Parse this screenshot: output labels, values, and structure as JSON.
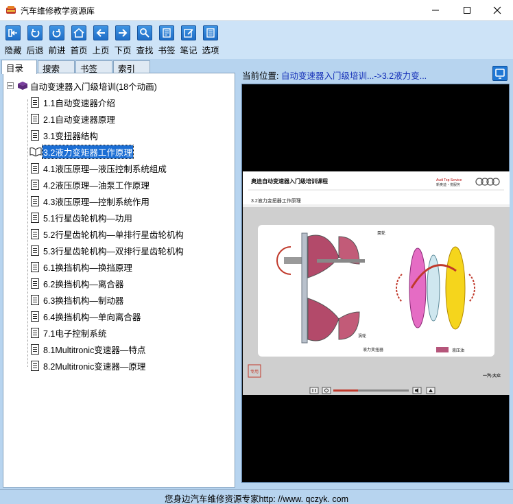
{
  "window": {
    "title": "汽车维修教学资源库"
  },
  "toolbar": {
    "items": [
      {
        "label": "隐藏",
        "icon": "hide-panel-icon"
      },
      {
        "label": "后退",
        "icon": "back-icon"
      },
      {
        "label": "前进",
        "icon": "forward-icon"
      },
      {
        "label": "首页",
        "icon": "home-icon"
      },
      {
        "label": "上页",
        "icon": "previous-page-icon"
      },
      {
        "label": "下页",
        "icon": "next-page-icon"
      },
      {
        "label": "查找",
        "icon": "search-icon"
      },
      {
        "label": "书签",
        "icon": "bookmark-icon"
      },
      {
        "label": "笔记",
        "icon": "note-icon"
      },
      {
        "label": "选项",
        "icon": "options-icon"
      }
    ]
  },
  "tabs": [
    "目录",
    "搜索",
    "书签",
    "索引"
  ],
  "tree": {
    "root_label": "自动变速器入门级培训(18个动画)",
    "items": [
      "1.1自动变速器介绍",
      "2.1自动变速器原理",
      "3.1变扭器结构",
      "3.2液力变矩器工作原理",
      "4.1液压原理—液压控制系统组成",
      "4.2液压原理—油泵工作原理",
      "4.3液压原理—控制系统作用",
      "5.1行星齿轮机构—功用",
      "5.2行星齿轮机构—单排行星齿轮机构",
      "5.3行星齿轮机构—双排行星齿轮机构",
      "6.1换挡机构—换挡原理",
      "6.2换挡机构—离合器",
      "6.3换挡机构—制动器",
      "6.4换挡机构—单向离合器",
      "7.1电子控制系统",
      "8.1Multitronic变速器—特点",
      "8.2Multitronic变速器—原理"
    ],
    "selected_index": 3
  },
  "location": {
    "label": "当前位置:",
    "value": "自动变速器入门级培训...->3.2液力变..."
  },
  "slide": {
    "course_title": "奥迪自动变速器入门级培训课程",
    "brand_line1": "Audi Top Service",
    "brand_line2": "新奥迪・悦服务",
    "section_title": "3.2液力变扭器工作原理",
    "label_pump": "泵轮",
    "label_turbine": "涡轮",
    "caption": "液力变扭器",
    "legend_label": "液压油",
    "footer_brand": "一汽-大众",
    "stamp": "专用"
  },
  "status": {
    "text": "您身边汽车维修资源专家http: //www. qczyk. com"
  },
  "colors": {
    "accent": "#1b6ed4",
    "panel": "#b7d4ef",
    "toolbar": "#cde3f7",
    "legend": "#b5557a"
  }
}
